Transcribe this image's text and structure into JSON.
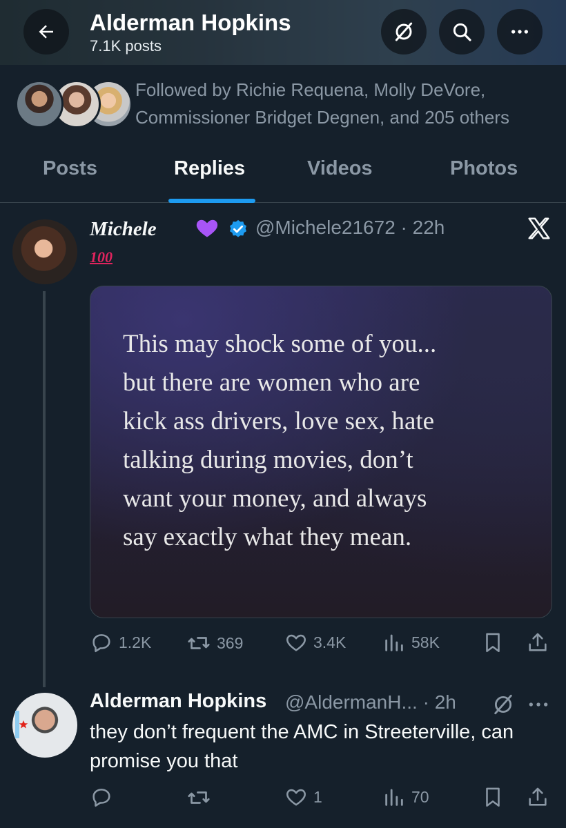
{
  "header": {
    "title": "Alderman Hopkins",
    "subtitle": "7.1K posts"
  },
  "followed_by": {
    "text": "Followed by Richie Requena, Molly DeVore, Commissioner Bridget Degnen, and 205 others"
  },
  "tabs": [
    {
      "label": "Posts",
      "active": false
    },
    {
      "label": "Replies",
      "active": true
    },
    {
      "label": "Videos",
      "active": false
    },
    {
      "label": "Photos",
      "active": false
    }
  ],
  "tweet1": {
    "display_name": "Michele",
    "name_emoji": "purple-heart",
    "verified": true,
    "handle_time": "@Michele21672 · 22h",
    "badge_text": "100",
    "image_text": "This may shock some of you...\nbut there are women who are\nkick ass drivers, love sex, hate\ntalking during movies, don’t\nwant your money, and always\nsay exactly what they mean.",
    "replies": "1.2K",
    "reposts": "369",
    "likes": "3.4K",
    "views": "58K"
  },
  "tweet2": {
    "display_name": "Alderman Hopkins",
    "handle_time": "@AldermanH... · 2h",
    "text": "they don’t frequent the AMC in Streeterville, can promise you that",
    "replies": "",
    "reposts": "",
    "likes": "1",
    "views": "70"
  },
  "colors": {
    "background": "#15202b",
    "accent": "#1d9bf0",
    "muted": "#8b98a5",
    "text": "#f7f9f9",
    "badge_red": "#e0245e"
  },
  "icons": [
    "back-arrow-icon",
    "grok-icon",
    "search-icon",
    "more-icon",
    "x-logo-icon",
    "verified-badge-icon",
    "reply-icon",
    "repost-icon",
    "like-icon",
    "views-icon",
    "bookmark-icon",
    "share-icon"
  ]
}
